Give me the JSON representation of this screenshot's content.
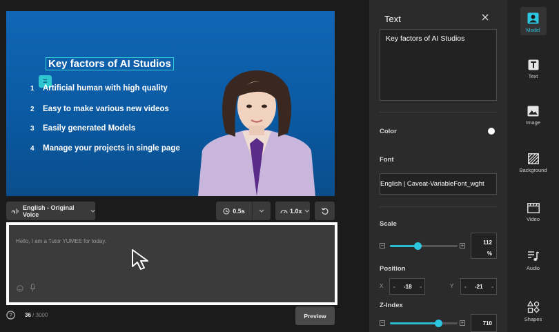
{
  "canvas": {
    "title": "Key factors of AI Studios",
    "bullets": [
      {
        "num": "1",
        "text": "Artificial human with high quality"
      },
      {
        "num": "2",
        "text": "Easy to make various new videos"
      },
      {
        "num": "3",
        "text": "Easily generated Models"
      },
      {
        "num": "4",
        "text": "Manage your projects in single page"
      }
    ]
  },
  "toolbar": {
    "voice_label": "English - Original Voice",
    "duration_label": "0.5s",
    "speed_label": "1.0x"
  },
  "editor": {
    "script_text": "Hello, I am a Tutor YUMEE for today.",
    "char_count_current": "36",
    "char_count_total": " / 3000",
    "preview_label": "Preview"
  },
  "panel": {
    "title": "Text",
    "text_value": "Key factors of AI Studios",
    "color_label": "Color",
    "color_value": "#ffffff",
    "font_label": "Font",
    "font_value": "English | Caveat-VariableFont_wght",
    "scale_label": "Scale",
    "scale_value": "112",
    "scale_unit": "%",
    "scale_fraction": 0.41,
    "position_label": "Position",
    "x_label": "X",
    "x_value": "-18",
    "y_label": "Y",
    "y_value": "-21",
    "zindex_label": "Z-Index",
    "zindex_value": "710",
    "zindex_fraction": 0.71
  },
  "sidebar": {
    "items": [
      {
        "label": "Model",
        "icon": "model-icon"
      },
      {
        "label": "Text",
        "icon": "text-icon"
      },
      {
        "label": "Image",
        "icon": "image-icon"
      },
      {
        "label": "Background",
        "icon": "background-icon"
      },
      {
        "label": "Video",
        "icon": "video-icon"
      },
      {
        "label": "Audio",
        "icon": "audio-icon"
      },
      {
        "label": "Shapes",
        "icon": "shapes-icon"
      }
    ]
  },
  "colors": {
    "accent": "#2dc6e0",
    "canvas_bg": "#0a5aa3"
  }
}
